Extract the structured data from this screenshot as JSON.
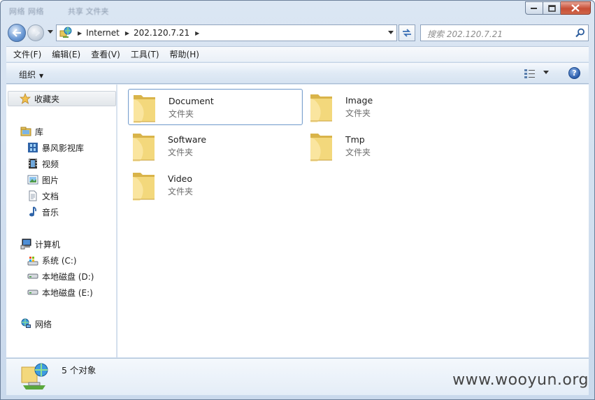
{
  "window": {
    "title_blur_1": "网络 网络",
    "title_blur_2": "共享 文件夹"
  },
  "address": {
    "parts": [
      "Internet",
      "202.120.7.21"
    ],
    "search_placeholder": "搜索 202.120.7.21"
  },
  "menu": [
    "文件(F)",
    "编辑(E)",
    "查看(V)",
    "工具(T)",
    "帮助(H)"
  ],
  "toolbar": {
    "organize_label": "组织",
    "help_label": "?"
  },
  "navpane": {
    "favorites": "收藏夹",
    "library": "库",
    "library_items": [
      "暴风影视库",
      "视频",
      "图片",
      "文档",
      "音乐"
    ],
    "computer": "计算机",
    "drives": [
      "系统 (C:)",
      "本地磁盘 (D:)",
      "本地磁盘 (E:)"
    ],
    "network": "网络"
  },
  "folders": [
    {
      "name": "Document",
      "type": "文件夹",
      "selected": true
    },
    {
      "name": "Image",
      "type": "文件夹",
      "selected": false
    },
    {
      "name": "Software",
      "type": "文件夹",
      "selected": false
    },
    {
      "name": "Tmp",
      "type": "文件夹",
      "selected": false
    },
    {
      "name": "Video",
      "type": "文件夹",
      "selected": false
    }
  ],
  "details": {
    "count_text": "5 个对象"
  },
  "watermark": "www.wooyun.org",
  "colors": {
    "folder_yellow": "#f2d675",
    "accent_blue": "#3c6fb4",
    "selection_border": "#7da2ce"
  }
}
